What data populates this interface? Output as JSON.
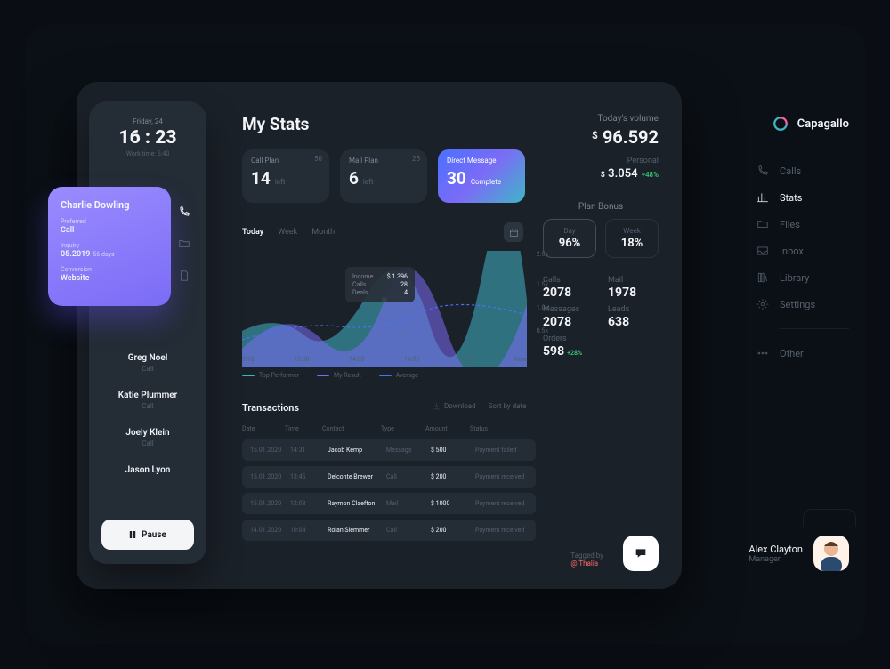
{
  "brand": "Capagallo",
  "nav": [
    {
      "icon": "phone",
      "label": "Calls"
    },
    {
      "icon": "stats",
      "label": "Stats"
    },
    {
      "icon": "files",
      "label": "Files"
    },
    {
      "icon": "inbox",
      "label": "Inbox"
    },
    {
      "icon": "library",
      "label": "Library"
    },
    {
      "icon": "settings",
      "label": "Settings"
    },
    {
      "icon": "other",
      "label": "Other"
    }
  ],
  "nav_active_index": 1,
  "user": {
    "name": "Alex Clayton",
    "role": "Manager"
  },
  "stats_title": "My Stats",
  "plan_cards": [
    {
      "title": "Call Plan",
      "value": "14",
      "unit": "left",
      "badge": "50"
    },
    {
      "title": "Mail Plan",
      "value": "6",
      "unit": "left",
      "badge": "25"
    },
    {
      "title": "Direct Message",
      "value": "30",
      "unit": "Complete",
      "badge": ""
    }
  ],
  "volume": {
    "label": "Today's volume",
    "value": "96.592",
    "personal_label": "Personal",
    "personal": "3.054",
    "delta": "+48%"
  },
  "bonus": {
    "title": "Plan Bonus",
    "day_label": "Day",
    "day": "96%",
    "week_label": "Week",
    "week": "18%"
  },
  "metrics": [
    {
      "k": "Calls",
      "v": "2078"
    },
    {
      "k": "Mail",
      "v": "1978"
    },
    {
      "k": "Messages",
      "v": "2078"
    },
    {
      "k": "Leads",
      "v": "638"
    },
    {
      "k": "Orders",
      "v": "598",
      "delta": "+28%"
    }
  ],
  "tagged": {
    "label": "Tagged by",
    "who": "@ Thalia"
  },
  "chart": {
    "tabs": [
      "Today",
      "Week",
      "Month"
    ],
    "active_tab": 0,
    "ylabels": [
      "2.5k",
      "1.5k",
      "1.0k",
      "0.5k"
    ],
    "xlabels": [
      "9:18",
      "12:00",
      "14:00",
      "16:00",
      "18:00",
      "Now"
    ],
    "legend": [
      {
        "label": "Top Performer",
        "color": "#3fb5c7"
      },
      {
        "label": "My Result",
        "color": "#7b6cf6"
      },
      {
        "label": "Average",
        "color": "#4a70ff"
      }
    ],
    "tooltip": {
      "rows": [
        [
          "Income",
          "$ 1.396"
        ],
        [
          "Calls",
          "28"
        ],
        [
          "Deals",
          "4"
        ]
      ]
    }
  },
  "chart_data": {
    "type": "area",
    "x": [
      "9:18",
      "12:00",
      "14:00",
      "16:00",
      "18:00",
      "Now"
    ],
    "ylim": [
      0,
      2500
    ],
    "series": [
      {
        "name": "Top Performer",
        "color": "#3fb5c7",
        "values": [
          900,
          700,
          1600,
          1300,
          2300,
          1800
        ]
      },
      {
        "name": "My Result",
        "color": "#7b6cf6",
        "values": [
          400,
          1100,
          600,
          1400,
          900,
          1500
        ]
      },
      {
        "name": "Average",
        "color": "#4a70ff",
        "values": [
          600,
          900,
          1000,
          1100,
          1300,
          1200
        ]
      }
    ],
    "tooltip_at_index": 2
  },
  "tx": {
    "title": "Transactions",
    "download": "Download",
    "sort": "Sort by date",
    "headers": [
      "Date",
      "Time",
      "Contact",
      "Type",
      "Amount",
      "Status"
    ],
    "rows": [
      {
        "color": "#7b6cf6",
        "date": "15.01.2020",
        "time": "14:31",
        "contact": "Jacob Kemp",
        "type": "Message",
        "amount": "$ 500",
        "status": "Payment failed"
      },
      {
        "color": "#3ad07a",
        "date": "15.01.2020",
        "time": "13:45",
        "contact": "Delconte Brewer",
        "type": "Call",
        "amount": "$ 200",
        "status": "Payment received"
      },
      {
        "color": "#3fb5c7",
        "date": "15.01.2020",
        "time": "12:08",
        "contact": "Raymon Claefton",
        "type": "Mail",
        "amount": "$ 1000",
        "status": "Payment received"
      },
      {
        "color": "#ff6b6b",
        "date": "14.01.2020",
        "time": "10:04",
        "contact": "Rolan Slemmer",
        "type": "Call",
        "amount": "$ 200",
        "status": "Payment received"
      }
    ]
  },
  "people": {
    "date": "Friday, 24",
    "time": "16 : 23",
    "worktime": "Work time: 5:40",
    "list": [
      {
        "name": "Greg Noel",
        "sub": "Call"
      },
      {
        "name": "Katie Plummer",
        "sub": "Call"
      },
      {
        "name": "Joely Klein",
        "sub": "Call"
      },
      {
        "name": "Jason Lyon",
        "sub": ""
      }
    ],
    "pause": "Pause"
  },
  "contact": {
    "name": "Charlie Dowling",
    "preferred_k": "Preferred",
    "preferred_v": "Call",
    "inquiry_k": "Inquiry",
    "inquiry_v": "05.2019",
    "inquiry_note": "56 days",
    "conv_k": "Conversion",
    "conv_v": "Website"
  }
}
